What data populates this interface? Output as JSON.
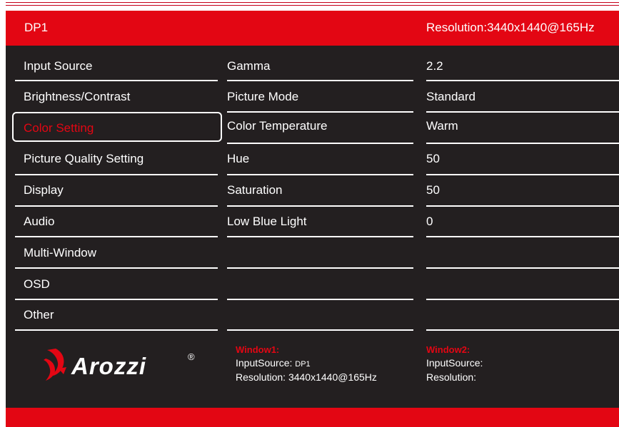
{
  "header": {
    "input": "DP1",
    "resolution_label": "Resolution:",
    "resolution_value": "3440x1440@165Hz"
  },
  "menu": {
    "items": [
      {
        "label": "Input Source"
      },
      {
        "label": "Brightness/Contrast"
      },
      {
        "label": "Color Setting",
        "selected": true
      },
      {
        "label": "Picture Quality Setting"
      },
      {
        "label": "Display"
      },
      {
        "label": "Audio"
      },
      {
        "label": "Multi-Window"
      },
      {
        "label": "OSD"
      },
      {
        "label": "Other"
      }
    ]
  },
  "params": [
    {
      "label": "Gamma",
      "value": "2.2"
    },
    {
      "label": "Picture Mode",
      "value": "Standard"
    },
    {
      "label": "Color Temperature",
      "value": "Warm"
    },
    {
      "label": "Hue",
      "value": "50"
    },
    {
      "label": "Saturation",
      "value": "50"
    },
    {
      "label": "Low Blue Light",
      "value": "0"
    }
  ],
  "logo": {
    "text": "Arozzi",
    "mark": "®"
  },
  "window1": {
    "title": "Window1:",
    "input_label": "InputSource:",
    "input_value": "DP1",
    "resolution_label": "Resolution:",
    "resolution_value": "3440x1440@165Hz"
  },
  "window2": {
    "title": "Window2:",
    "input_label": "InputSource:",
    "resolution_label": "Resolution:"
  },
  "colors": {
    "accent": "#e30613",
    "background": "#231f20",
    "text": "#ffffff"
  }
}
